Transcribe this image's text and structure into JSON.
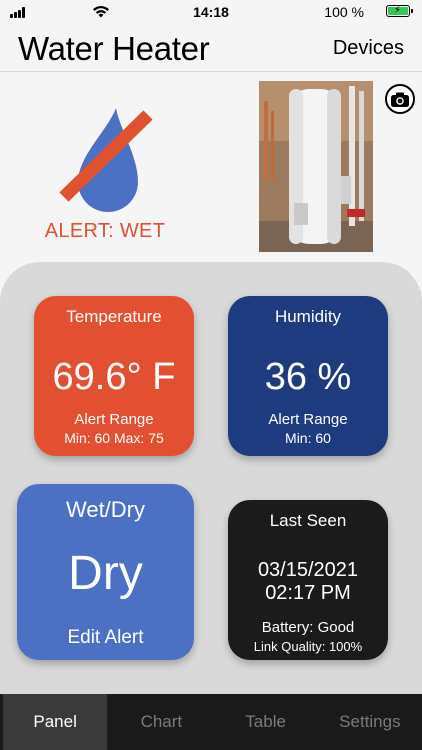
{
  "status_bar": {
    "time": "14:18",
    "battery_percent": "100 %",
    "battery_color": "#34c759"
  },
  "header": {
    "title": "Water Heater",
    "devices_label": "Devices"
  },
  "alert": {
    "text": "ALERT: WET",
    "icon": "water-drop-crossed-icon",
    "color": "#e0522f"
  },
  "photo": {
    "camera_icon": "camera-icon"
  },
  "tiles": {
    "temperature": {
      "title": "Temperature",
      "value": "69.6° F",
      "range_label": "Alert Range",
      "range": "Min: 60 Max: 75",
      "color": "#e34f31"
    },
    "humidity": {
      "title": "Humidity",
      "value": "36 %",
      "range_label": "Alert Range",
      "range": "Min: 60",
      "color": "#1f3b80"
    },
    "wetdry": {
      "title": "Wet/Dry",
      "value": "Dry",
      "edit_label": "Edit Alert",
      "color": "#4c70c4"
    },
    "last_seen": {
      "title": "Last Seen",
      "date": "03/15/2021",
      "time": "02:17 PM",
      "battery": "Battery: Good",
      "link_quality": "Link Quality: 100%",
      "color": "#1b1b1b"
    }
  },
  "tabs": [
    {
      "label": "Panel",
      "active": true
    },
    {
      "label": "Chart",
      "active": false
    },
    {
      "label": "Table",
      "active": false
    },
    {
      "label": "Settings",
      "active": false
    }
  ]
}
